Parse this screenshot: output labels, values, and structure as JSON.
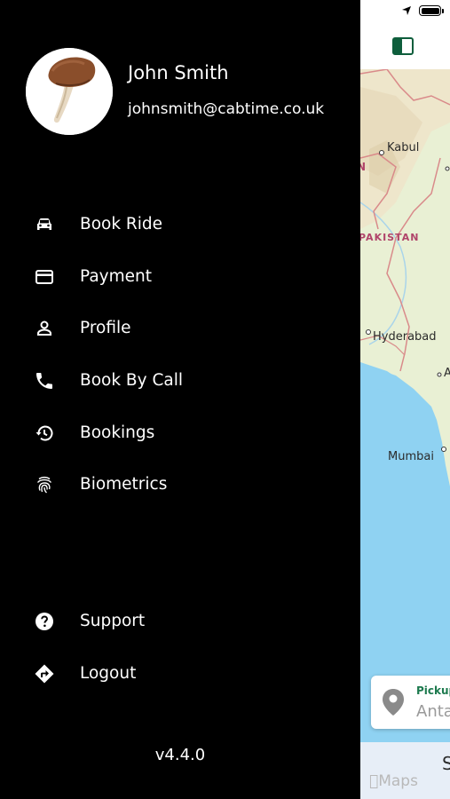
{
  "drawer": {
    "user": {
      "name": "John Smith",
      "email": "johnsmith@cabtime.co.uk"
    },
    "menu": [
      {
        "label": "Book Ride",
        "icon": "car-icon"
      },
      {
        "label": "Payment",
        "icon": "credit-card-icon"
      },
      {
        "label": "Profile",
        "icon": "person-icon"
      },
      {
        "label": "Book By Call",
        "icon": "phone-icon"
      },
      {
        "label": "Bookings",
        "icon": "history-icon"
      },
      {
        "label": "Biometrics",
        "icon": "fingerprint-icon"
      }
    ],
    "footer_menu": [
      {
        "label": "Support",
        "icon": "help-circle-icon"
      },
      {
        "label": "Logout",
        "icon": "directions-icon"
      }
    ],
    "version": "v4.4.0"
  },
  "map": {
    "cities": {
      "kabul": "Kabul",
      "hyderabad": "Hyderabad",
      "mumbai": "Mumbai"
    },
    "country_label": "PAKISTAN",
    "partial_labels": {
      "left_n": "N",
      "right_a": "A"
    },
    "attribution": "Maps"
  },
  "pickup": {
    "label": "Pickup",
    "value": "Anta"
  },
  "bottom_button": {
    "label": "S"
  },
  "colors": {
    "drawer_bg": "#000000",
    "accent_green": "#1d7a4e",
    "land": "#e9f0d4",
    "water": "#8fd2f2",
    "border": "#d98a8a"
  }
}
